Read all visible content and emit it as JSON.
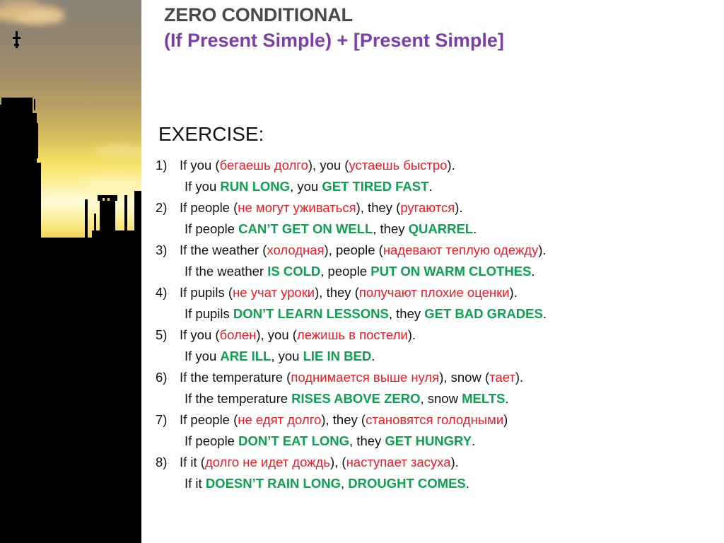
{
  "slide": {
    "title_main": "ZERO CONDITIONAL",
    "title_sub": "(If Present Simple) + [Present Simple]",
    "exercise_heading": "EXERCISE:",
    "image_caption": "big-ben-sunset-silhouette"
  },
  "colors": {
    "title_gray": "#4a4a4a",
    "title_purple": "#7b3fa8",
    "russian_red": "#ed1c24",
    "english_green": "#0ca14f",
    "body_black": "#111111",
    "sky_top": "#8b8377",
    "sky_glow": "#fffad2",
    "silhouette": "#000000"
  },
  "exercises": [
    {
      "number": "1)",
      "prompt": [
        {
          "t": "If you (",
          "c": "black"
        },
        {
          "t": "бегаешь долго",
          "c": "ru"
        },
        {
          "t": "), you (",
          "c": "black"
        },
        {
          "t": "устаешь быстро",
          "c": "ru"
        },
        {
          "t": ").",
          "c": "black"
        }
      ],
      "answer": [
        {
          "t": "If you ",
          "c": "black"
        },
        {
          "t": "RUN LONG",
          "c": "en"
        },
        {
          "t": ", you ",
          "c": "black"
        },
        {
          "t": "GET TIRED FAST",
          "c": "en"
        },
        {
          "t": ".",
          "c": "black"
        }
      ]
    },
    {
      "number": "2)",
      "prompt": [
        {
          "t": "If people (",
          "c": "black"
        },
        {
          "t": "не могут уживаться",
          "c": "ru"
        },
        {
          "t": "), they (",
          "c": "black"
        },
        {
          "t": "ругаются",
          "c": "ru"
        },
        {
          "t": ").",
          "c": "black"
        }
      ],
      "answer": [
        {
          "t": "If people ",
          "c": "black"
        },
        {
          "t": "CAN’T GET ON WELL",
          "c": "en"
        },
        {
          "t": ", they ",
          "c": "black"
        },
        {
          "t": "QUARREL",
          "c": "en"
        },
        {
          "t": ".",
          "c": "black"
        }
      ]
    },
    {
      "number": "3)",
      "prompt": [
        {
          "t": "If the weather (",
          "c": "black"
        },
        {
          "t": "холодная",
          "c": "ru"
        },
        {
          "t": "), people (",
          "c": "black"
        },
        {
          "t": "надевают теплую одежду",
          "c": "ru"
        },
        {
          "t": ").",
          "c": "black"
        }
      ],
      "answer": [
        {
          "t": "If the weather ",
          "c": "black"
        },
        {
          "t": "IS COLD",
          "c": "en"
        },
        {
          "t": ", people ",
          "c": "black"
        },
        {
          "t": "PUT ON WARM CLOTHES",
          "c": "en"
        },
        {
          "t": ".",
          "c": "black"
        }
      ]
    },
    {
      "number": "4)",
      "prompt": [
        {
          "t": "If pupils (",
          "c": "black"
        },
        {
          "t": "не учат уроки",
          "c": "ru"
        },
        {
          "t": "), they (",
          "c": "black"
        },
        {
          "t": "получают плохие оценки",
          "c": "ru"
        },
        {
          "t": ").",
          "c": "black"
        }
      ],
      "answer": [
        {
          "t": "If pupils ",
          "c": "black"
        },
        {
          "t": "DON’T LEARN LESSONS",
          "c": "en"
        },
        {
          "t": ", they ",
          "c": "black"
        },
        {
          "t": "GET BAD GRADES",
          "c": "en"
        },
        {
          "t": ".",
          "c": "black"
        }
      ]
    },
    {
      "number": "5)",
      "prompt": [
        {
          "t": "If you (",
          "c": "black"
        },
        {
          "t": "болен",
          "c": "ru"
        },
        {
          "t": "), you (",
          "c": "black"
        },
        {
          "t": "лежишь в постели",
          "c": "ru"
        },
        {
          "t": ").",
          "c": "black"
        }
      ],
      "answer": [
        {
          "t": "If you ",
          "c": "black"
        },
        {
          "t": "ARE ILL",
          "c": "en"
        },
        {
          "t": ", you ",
          "c": "black"
        },
        {
          "t": "LIE IN BED",
          "c": "en"
        },
        {
          "t": ".",
          "c": "black"
        }
      ]
    },
    {
      "number": "6)",
      "prompt": [
        {
          "t": "If the temperature (",
          "c": "black"
        },
        {
          "t": "поднимается выше нуля",
          "c": "ru"
        },
        {
          "t": "), snow (",
          "c": "black"
        },
        {
          "t": "тает",
          "c": "ru"
        },
        {
          "t": ").",
          "c": "black"
        }
      ],
      "answer": [
        {
          "t": "If the temperature ",
          "c": "black"
        },
        {
          "t": "RISES ABOVE ZERO",
          "c": "en"
        },
        {
          "t": ", snow ",
          "c": "black"
        },
        {
          "t": "MELTS",
          "c": "en"
        },
        {
          "t": ".",
          "c": "black"
        }
      ]
    },
    {
      "number": "7)",
      "prompt": [
        {
          "t": "If people (",
          "c": "black"
        },
        {
          "t": "не едят долго",
          "c": "ru"
        },
        {
          "t": "), they (",
          "c": "black"
        },
        {
          "t": "становятся голодными",
          "c": "ru"
        },
        {
          "t": ")",
          "c": "black"
        }
      ],
      "answer": [
        {
          "t": "If people ",
          "c": "black"
        },
        {
          "t": "DON’T EAT LONG",
          "c": "en"
        },
        {
          "t": ", they ",
          "c": "black"
        },
        {
          "t": "GET HUNGRY",
          "c": "en"
        },
        {
          "t": ".",
          "c": "black"
        }
      ]
    },
    {
      "number": "8)",
      "prompt": [
        {
          "t": "If it (",
          "c": "black"
        },
        {
          "t": "долго не идет дождь",
          "c": "ru"
        },
        {
          "t": "), (",
          "c": "black"
        },
        {
          "t": "наступает засуха",
          "c": "ru"
        },
        {
          "t": ").",
          "c": "black"
        }
      ],
      "answer": [
        {
          "t": "If it ",
          "c": "black"
        },
        {
          "t": "DOESN’T RAIN LONG",
          "c": "en"
        },
        {
          "t": ", ",
          "c": "black"
        },
        {
          "t": "DROUGHT COMES",
          "c": "en"
        },
        {
          "t": ".",
          "c": "black"
        }
      ]
    }
  ]
}
